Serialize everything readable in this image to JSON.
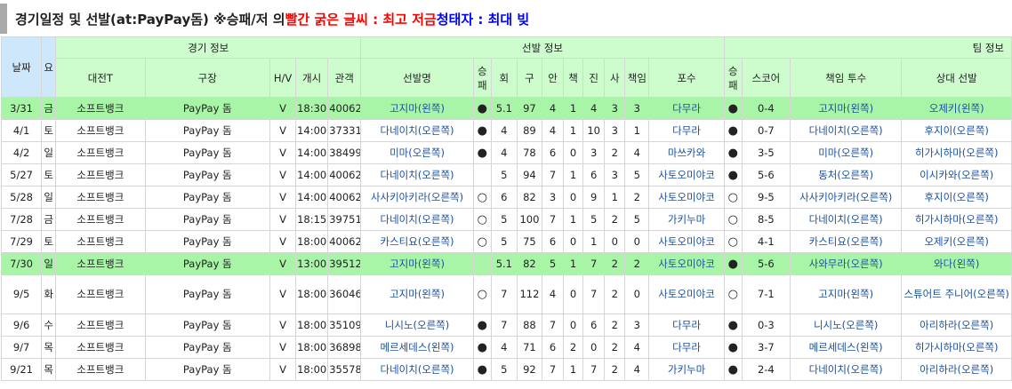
{
  "title": {
    "part1": "경기일정 및 선발(at:PayPay돔) ※승패/저 의 ",
    "red_part": "빨간 굵은 글씨 : 최고 저금",
    "mid": " ",
    "blue_part": "청태자 : 최대 빚"
  },
  "groups": {
    "game_info": "경기 정보",
    "starter_info": "선발 정보",
    "team_info": "팀 정보"
  },
  "headers": {
    "date": "날짜",
    "day": "요",
    "opponent": "대전T",
    "stadium": "구장",
    "hv": "H/V",
    "start": "개시",
    "attendance": "관객",
    "starter": "선발명",
    "wl": "승패",
    "inn": "회",
    "pitches": "구",
    "hits": "안",
    "bb": "책",
    "k": "진",
    "so": "사",
    "er": "책임",
    "catcher": "포수",
    "team_wl": "승패",
    "score": "스코어",
    "resp_pitcher": "책임 투수",
    "opp_starter": "상대 선발"
  },
  "rows": [
    {
      "date": "3/31",
      "day": "금",
      "opp": "소프트뱅크",
      "stadium": "PayPay 돔",
      "hv": "V",
      "start": "18:30",
      "att": "40062",
      "starter": "고지마(왼쪽)",
      "wl": "●",
      "inn": "5.1",
      "pitches": "97",
      "hits": "4",
      "bb": "1",
      "k": "4",
      "so": "3",
      "er": "3",
      "catcher": "다무라",
      "twl": "●",
      "score": "0-4",
      "resp": "고지마(왼쪽)",
      "opp_starter": "오제키(왼쪽)",
      "hl": true
    },
    {
      "date": "4/1",
      "day": "토",
      "opp": "소프트뱅크",
      "stadium": "PayPay 돔",
      "hv": "V",
      "start": "14:00",
      "att": "37331",
      "starter": "다네이치(오른쪽)",
      "wl": "●",
      "inn": "4",
      "pitches": "89",
      "hits": "4",
      "bb": "1",
      "k": "10",
      "so": "3",
      "er": "1",
      "catcher": "다무라",
      "twl": "●",
      "score": "0-7",
      "resp": "다네이치(오른쪽)",
      "opp_starter": "후지이(오른쪽)",
      "hl": false
    },
    {
      "date": "4/2",
      "day": "일",
      "opp": "소프트뱅크",
      "stadium": "PayPay 돔",
      "hv": "V",
      "start": "14:00",
      "att": "38499",
      "starter": "미마(오른쪽)",
      "wl": "●",
      "inn": "4",
      "pitches": "78",
      "hits": "6",
      "bb": "0",
      "k": "3",
      "so": "2",
      "er": "4",
      "catcher": "마쓰카와",
      "twl": "●",
      "score": "3-5",
      "resp": "미마(오른쪽)",
      "opp_starter": "히가시하마(오른쪽)",
      "hl": false
    },
    {
      "date": "5/27",
      "day": "토",
      "opp": "소프트뱅크",
      "stadium": "PayPay 돔",
      "hv": "V",
      "start": "14:00",
      "att": "40062",
      "starter": "다네이치(오른쪽)",
      "wl": "",
      "inn": "5",
      "pitches": "94",
      "hits": "7",
      "bb": "1",
      "k": "6",
      "so": "3",
      "er": "5",
      "catcher": "사토오미야코",
      "twl": "●",
      "score": "5-6",
      "resp": "동처(오른쪽)",
      "opp_starter": "이시카와(오른쪽)",
      "hl": false
    },
    {
      "date": "5/28",
      "day": "일",
      "opp": "소프트뱅크",
      "stadium": "PayPay 돔",
      "hv": "V",
      "start": "14:00",
      "att": "40062",
      "starter": "사사키아키라(오른쪽)",
      "wl": "○",
      "inn": "6",
      "pitches": "82",
      "hits": "3",
      "bb": "0",
      "k": "9",
      "so": "1",
      "er": "2",
      "catcher": "사토오미야코",
      "twl": "○",
      "score": "9-5",
      "resp": "사사키아키라(오른쪽)",
      "opp_starter": "후지이(오른쪽)",
      "hl": false
    },
    {
      "date": "7/28",
      "day": "금",
      "opp": "소프트뱅크",
      "stadium": "PayPay 돔",
      "hv": "V",
      "start": "18:15",
      "att": "39751",
      "starter": "다네이치(오른쪽)",
      "wl": "○",
      "inn": "5",
      "pitches": "100",
      "hits": "7",
      "bb": "1",
      "k": "5",
      "so": "2",
      "er": "5",
      "catcher": "가키누마",
      "twl": "○",
      "score": "8-5",
      "resp": "다네이치(오른쪽)",
      "opp_starter": "히가시하마(오른쪽)",
      "hl": false
    },
    {
      "date": "7/29",
      "day": "토",
      "opp": "소프트뱅크",
      "stadium": "PayPay 돔",
      "hv": "V",
      "start": "18:00",
      "att": "40062",
      "starter": "카스티요(오른쪽)",
      "wl": "○",
      "inn": "5",
      "pitches": "75",
      "hits": "6",
      "bb": "0",
      "k": "1",
      "so": "0",
      "er": "0",
      "catcher": "사토오미야코",
      "twl": "○",
      "score": "4-1",
      "resp": "카스티요(오른쪽)",
      "opp_starter": "오제키(오른쪽)",
      "hl": false
    },
    {
      "date": "7/30",
      "day": "일",
      "opp": "소프트뱅크",
      "stadium": "PayPay 돔",
      "hv": "V",
      "start": "13:00",
      "att": "39512",
      "starter": "고지마(왼쪽)",
      "wl": "",
      "inn": "5.1",
      "pitches": "82",
      "hits": "5",
      "bb": "1",
      "k": "7",
      "so": "2",
      "er": "2",
      "catcher": "사토오미야코",
      "twl": "●",
      "score": "5-6",
      "resp": "사와무라(오른쪽)",
      "opp_starter": "와다(왼쪽)",
      "hl": true
    },
    {
      "date": "9/5",
      "day": "화",
      "opp": "소프트뱅크",
      "stadium": "PayPay 돔",
      "hv": "V",
      "start": "18:00",
      "att": "36046",
      "starter": "고지마(왼쪽)",
      "wl": "○",
      "inn": "7",
      "pitches": "112",
      "hits": "4",
      "bb": "0",
      "k": "7",
      "so": "2",
      "er": "0",
      "catcher": "사토오미야코",
      "twl": "○",
      "score": "7-1",
      "resp": "고지마(왼쪽)",
      "opp_starter": "스튜어트 주니어(오른쪽)",
      "hl": false,
      "tall": true
    },
    {
      "date": "9/6",
      "day": "수",
      "opp": "소프트뱅크",
      "stadium": "PayPay 돔",
      "hv": "V",
      "start": "18:00",
      "att": "35109",
      "starter": "니시노(오른쪽)",
      "wl": "●",
      "inn": "7",
      "pitches": "88",
      "hits": "7",
      "bb": "0",
      "k": "6",
      "so": "2",
      "er": "3",
      "catcher": "다무라",
      "twl": "●",
      "score": "0-3",
      "resp": "니시노(오른쪽)",
      "opp_starter": "아리하라(오른쪽)",
      "hl": false
    },
    {
      "date": "9/7",
      "day": "목",
      "opp": "소프트뱅크",
      "stadium": "PayPay 돔",
      "hv": "V",
      "start": "18:00",
      "att": "36898",
      "starter": "메르세데스(왼쪽)",
      "wl": "●",
      "inn": "4",
      "pitches": "71",
      "hits": "6",
      "bb": "2",
      "k": "0",
      "so": "2",
      "er": "4",
      "catcher": "다무라",
      "twl": "●",
      "score": "3-7",
      "resp": "메르세데스(왼쪽)",
      "opp_starter": "히가시하마(오른쪽)",
      "hl": false
    },
    {
      "date": "9/21",
      "day": "목",
      "opp": "소프트뱅크",
      "stadium": "PayPay 돔",
      "hv": "V",
      "start": "18:00",
      "att": "35578",
      "starter": "다네이치(오른쪽)",
      "wl": "●",
      "inn": "5",
      "pitches": "92",
      "hits": "7",
      "bb": "1",
      "k": "7",
      "so": "2",
      "er": "4",
      "catcher": "가키누마",
      "twl": "●",
      "score": "2-4",
      "resp": "다네이치(오른쪽)",
      "opp_starter": "아리하라(오른쪽)",
      "hl": false
    }
  ]
}
